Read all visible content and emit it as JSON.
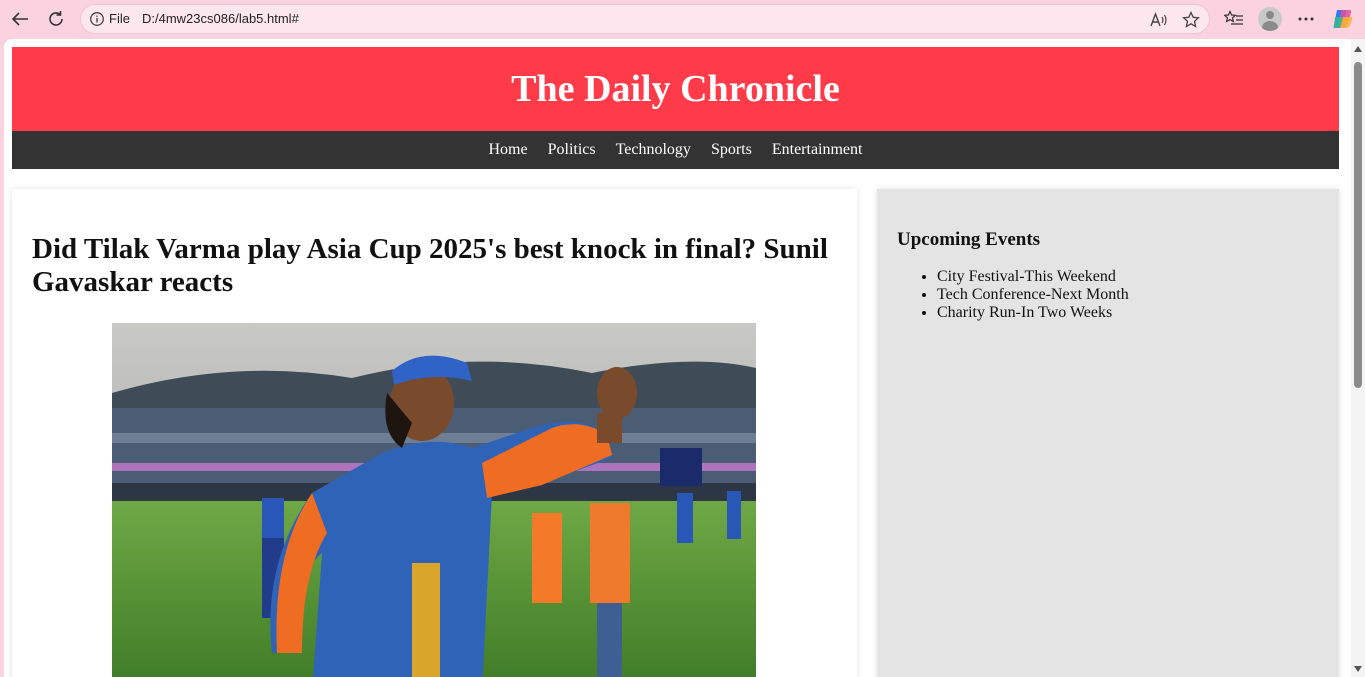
{
  "browser": {
    "file_label": "File",
    "url": "D:/4mw23cs086/lab5.html#"
  },
  "site": {
    "title": "The Daily Chronicle",
    "nav": [
      "Home",
      "Politics",
      "Technology",
      "Sports",
      "Entertainment"
    ]
  },
  "article": {
    "headline": "Did Tilak Varma play Asia Cup 2025's best knock in final? Sunil Gavaskar reacts"
  },
  "sidebar": {
    "heading": "Upcoming Events",
    "events": [
      "City Festival-This Weekend",
      "Tech Conference-Next Month",
      "Charity Run-In Two Weeks"
    ]
  },
  "colors": {
    "masthead": "#ff3b4a",
    "nav": "#333333",
    "sidebar": "#e4e4e4",
    "browser_frame": "#fbd3e0"
  }
}
